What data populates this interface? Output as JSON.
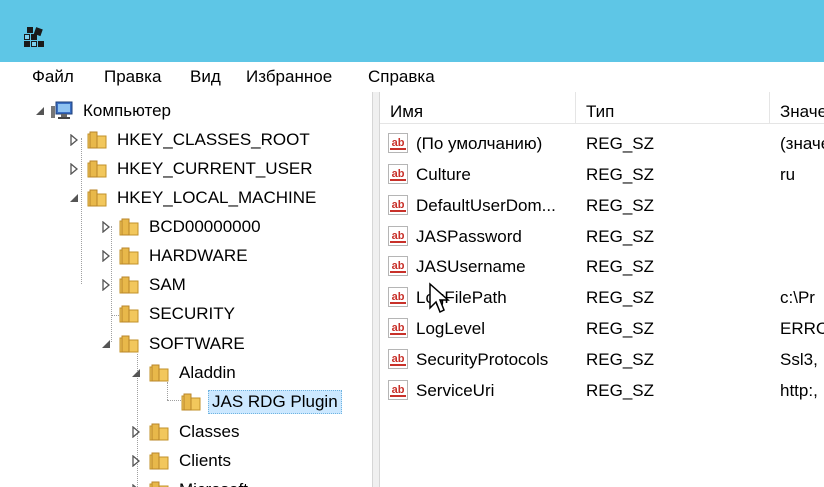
{
  "menu": {
    "file": "Файл",
    "edit": "Правка",
    "view": "Вид",
    "favorites": "Избранное",
    "help": "Справка"
  },
  "tree": {
    "computer": "Компьютер",
    "hkcr": "HKEY_CLASSES_ROOT",
    "hkcu": "HKEY_CURRENT_USER",
    "hklm": "HKEY_LOCAL_MACHINE",
    "bcd": "BCD00000000",
    "hardware": "HARDWARE",
    "sam": "SAM",
    "security": "SECURITY",
    "software": "SOFTWARE",
    "aladdin": "Aladdin",
    "jas": "JAS RDG Plugin",
    "classes": "Classes",
    "clients": "Clients",
    "microsoft": "Microsoft"
  },
  "columns": {
    "name": "Имя",
    "type": "Тип",
    "value": "Значение"
  },
  "values": [
    {
      "name": "(По умолчанию)",
      "type": "REG_SZ",
      "data": "(значение не присвоено)"
    },
    {
      "name": "Culture",
      "type": "REG_SZ",
      "data": "ru"
    },
    {
      "name": "DefaultUserDom...",
      "type": "REG_SZ",
      "data": ""
    },
    {
      "name": "JASPassword",
      "type": "REG_SZ",
      "data": ""
    },
    {
      "name": "JASUsername",
      "type": "REG_SZ",
      "data": ""
    },
    {
      "name": "LogFilePath",
      "type": "REG_SZ",
      "data": "c:\\Pr"
    },
    {
      "name": "LogLevel",
      "type": "REG_SZ",
      "data": "ERRC"
    },
    {
      "name": "SecurityProtocols",
      "type": "REG_SZ",
      "data": "Ssl3,"
    },
    {
      "name": "ServiceUri",
      "type": "REG_SZ",
      "data": "http:,"
    }
  ],
  "colors": {
    "titlebar": "#5ec6e6",
    "selection": "#cce8ff",
    "folder": "#e8b84a",
    "ab_icon_red": "#c8312a"
  }
}
